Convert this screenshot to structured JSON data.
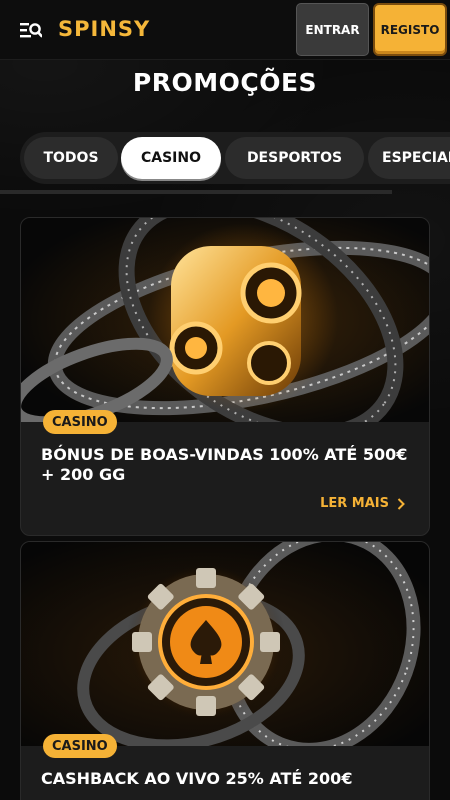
{
  "header": {
    "logo": "SPINSY",
    "login_label": "ENTRAR",
    "register_label": "REGISTO"
  },
  "page_title": "PROMOÇÕES",
  "tabs": [
    {
      "label": "TODOS",
      "active": false
    },
    {
      "label": "CASINO",
      "active": true
    },
    {
      "label": "DESPORTOS",
      "active": false
    },
    {
      "label": "ESPECIAIS",
      "active": false
    }
  ],
  "promos": [
    {
      "badge": "CASINO",
      "title": "BÓNUS DE BOAS-VINDAS 100% ATÉ 500€ + 200 GG",
      "read_more": "LER MAIS"
    },
    {
      "badge": "CASINO",
      "title": "CASHBACK AO VIVO 25% ATÉ 200€"
    }
  ],
  "colors": {
    "accent": "#f5b236",
    "background": "#0b0b0b",
    "card": "#1c1c1c"
  }
}
